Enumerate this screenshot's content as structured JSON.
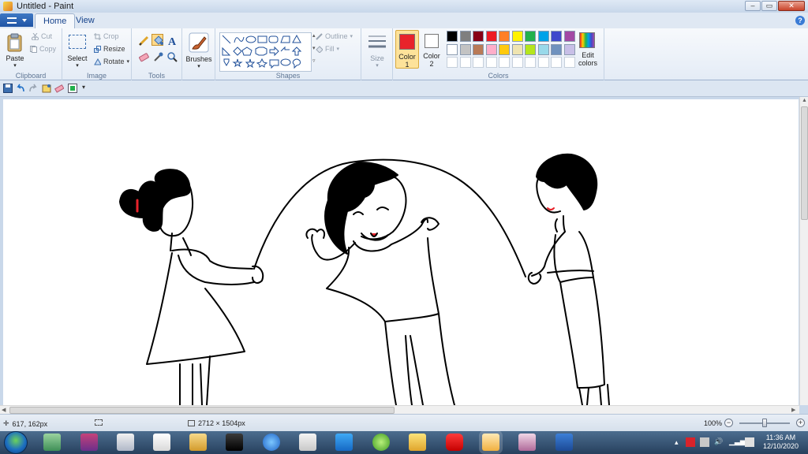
{
  "window": {
    "title": "Untitled - Paint"
  },
  "tabs": [
    {
      "label": "Home"
    },
    {
      "label": "View"
    }
  ],
  "ribbon": {
    "clipboard": {
      "paste": "Paste",
      "cut": "Cut",
      "copy": "Copy",
      "group": "Clipboard"
    },
    "image": {
      "select": "Select",
      "crop": "Crop",
      "resize": "Resize",
      "rotate": "Rotate",
      "group": "Image"
    },
    "tools": {
      "group": "Tools",
      "active_tool": "fill-icon"
    },
    "brushes": {
      "label": "Brushes"
    },
    "shapes": {
      "outline": "Outline",
      "fill": "Fill",
      "group": "Shapes"
    },
    "size": {
      "label": "Size"
    },
    "colors": {
      "color1_label": "Color 1",
      "color1_text": "Color",
      "color1_num": "1",
      "color1_value": "#e8232b",
      "color2_label": "Color 2",
      "color2_text": "Color",
      "color2_num": "2",
      "color2_value": "#ffffff",
      "edit_text_1": "Edit",
      "edit_text_2": "colors",
      "group": "Colors",
      "palette_row1": [
        "#000000",
        "#7f7f7f",
        "#880015",
        "#ed1c24",
        "#ff7f27",
        "#fff200",
        "#22b14c",
        "#00a2e8",
        "#3f48cc",
        "#a349a4"
      ],
      "palette_row2": [
        "#ffffff",
        "#c3c3c3",
        "#b97a57",
        "#ffaec9",
        "#ffc90e",
        "#efe4b0",
        "#b5e61d",
        "#99d9ea",
        "#7092be",
        "#c8bfe7"
      ]
    }
  },
  "statusbar": {
    "cursor_pos": "617, 162px",
    "image_size": "2712 × 1504px",
    "zoom": "100%"
  },
  "taskbar": {
    "time": "11:36 AM",
    "date": "12/10/2020"
  }
}
